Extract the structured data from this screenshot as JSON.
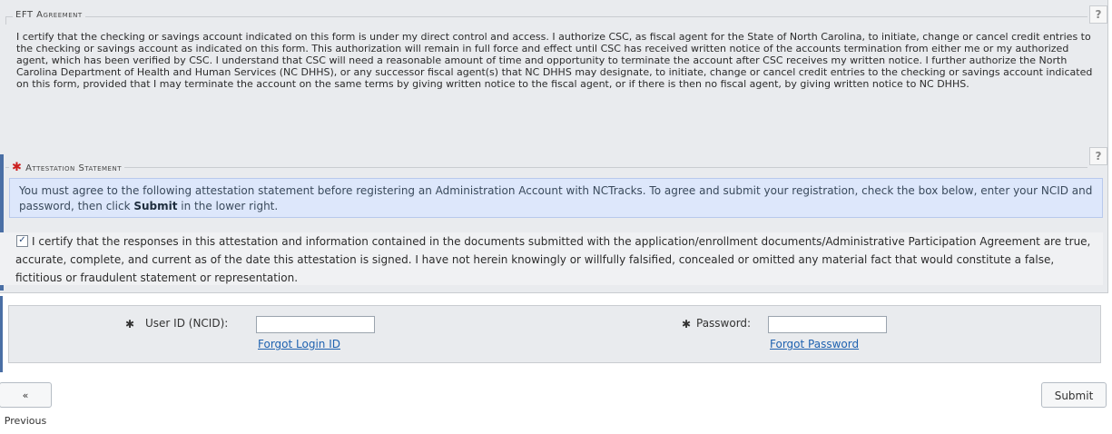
{
  "eft": {
    "legend": "EFT Agreement",
    "help": "?",
    "text": "I certify that the checking or savings account indicated on this form is under my direct control and access. I authorize CSC, as fiscal agent for the State of North Carolina, to initiate, change or cancel credit entries to the checking or savings account as indicated on this form. This authorization will remain in full force and effect until CSC has received written notice of the accounts termination from either me or my authorized agent, which has been verified by CSC. I understand that CSC will need a reasonable amount of time and opportunity to terminate the account after CSC receives my written notice. I further authorize the North Carolina Department of Health and Human Services (NC DHHS), or any successor fiscal agent(s) that NC DHHS may designate, to initiate, change or cancel credit entries to the checking or savings account indicated on this form, provided that I may terminate the account on the same terms by giving written notice to the fiscal agent, or if there is then no fiscal agent, by giving written notice to NC DHHS."
  },
  "attestation": {
    "required_mark": "✱",
    "legend": "Attestation Statement",
    "help": "?",
    "info_before": "You must agree to the following attestation statement before registering an Administration Account with NCTracks. To agree and submit your registration, check the box below, enter your NCID and password, then click ",
    "info_bold": "Submit",
    "info_after": " in the lower right.",
    "checkbox_checked": true,
    "checkbox_glyph": "✓",
    "cert_text": "I certify that the responses in this attestation and information contained in the documents submitted with the application/enrollment documents/Administrative Participation Agreement are true, accurate, complete, and current as of the date this attestation is signed. I have not herein knowingly or willfully falsified, concealed or omitted any material fact that would constitute a false, fictitious or fraudulent statement or representation."
  },
  "login": {
    "required_mark": "✱",
    "user_label": "User ID (NCID):",
    "user_value": "",
    "forgot_login": "Forgot Login ID",
    "password_label": "Password:",
    "password_value": "",
    "forgot_password": "Forgot Password"
  },
  "nav": {
    "previous": "« Previous",
    "submit": "Submit"
  },
  "colors": {
    "required": "#cc1f1f",
    "link": "#1f62b0",
    "accent": "#4a6fa5"
  }
}
